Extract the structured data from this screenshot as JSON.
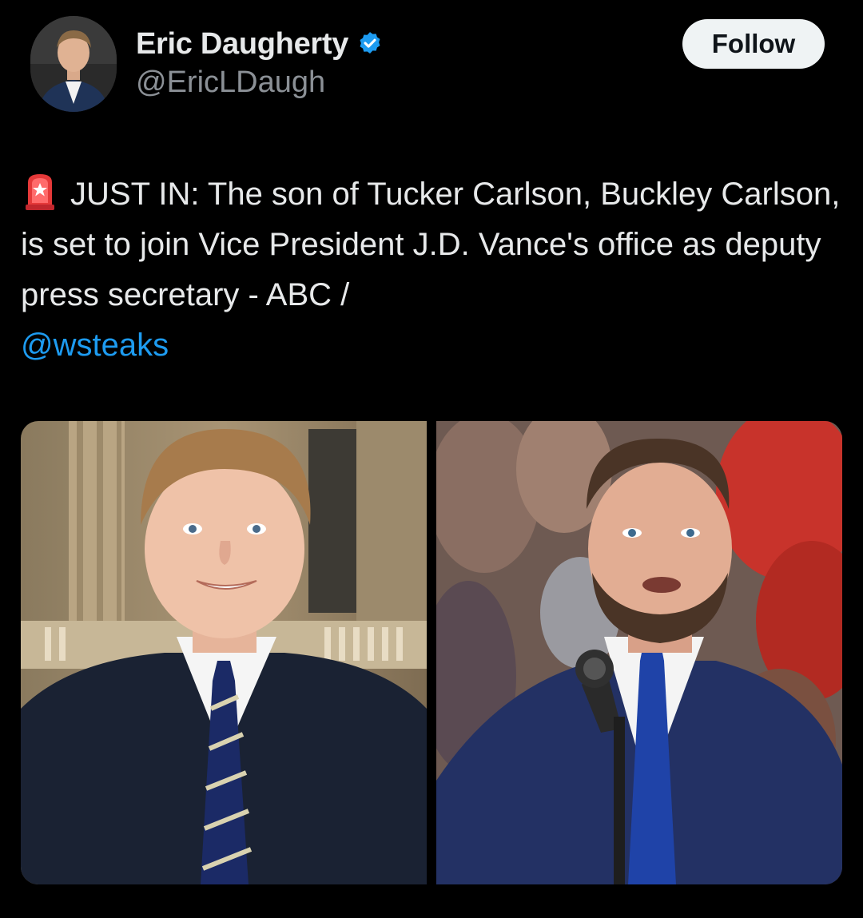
{
  "author": {
    "display_name": "Eric Daugherty",
    "handle": "@EricLDaugh",
    "verified": true,
    "avatar_icon": "user-avatar"
  },
  "actions": {
    "follow_label": "Follow"
  },
  "tweet": {
    "emoji_icon": "police-siren-icon",
    "text": "JUST IN: The son of Tucker Carlson, Buckley Carlson, is set to join Vice President J.D. Vance's office as deputy press secretary - ABC / ",
    "mention": "@wsteaks"
  },
  "media": {
    "photos": [
      {
        "subject": "young man in navy suit and striped tie"
      },
      {
        "subject": "man with beard speaking at microphone"
      }
    ]
  },
  "colors": {
    "background": "#000000",
    "text_primary": "#e7e9ea",
    "text_secondary": "#8b9096",
    "link": "#1d9bf0",
    "verified_badge": "#1d9bf0",
    "follow_button_bg": "#eff3f4"
  }
}
